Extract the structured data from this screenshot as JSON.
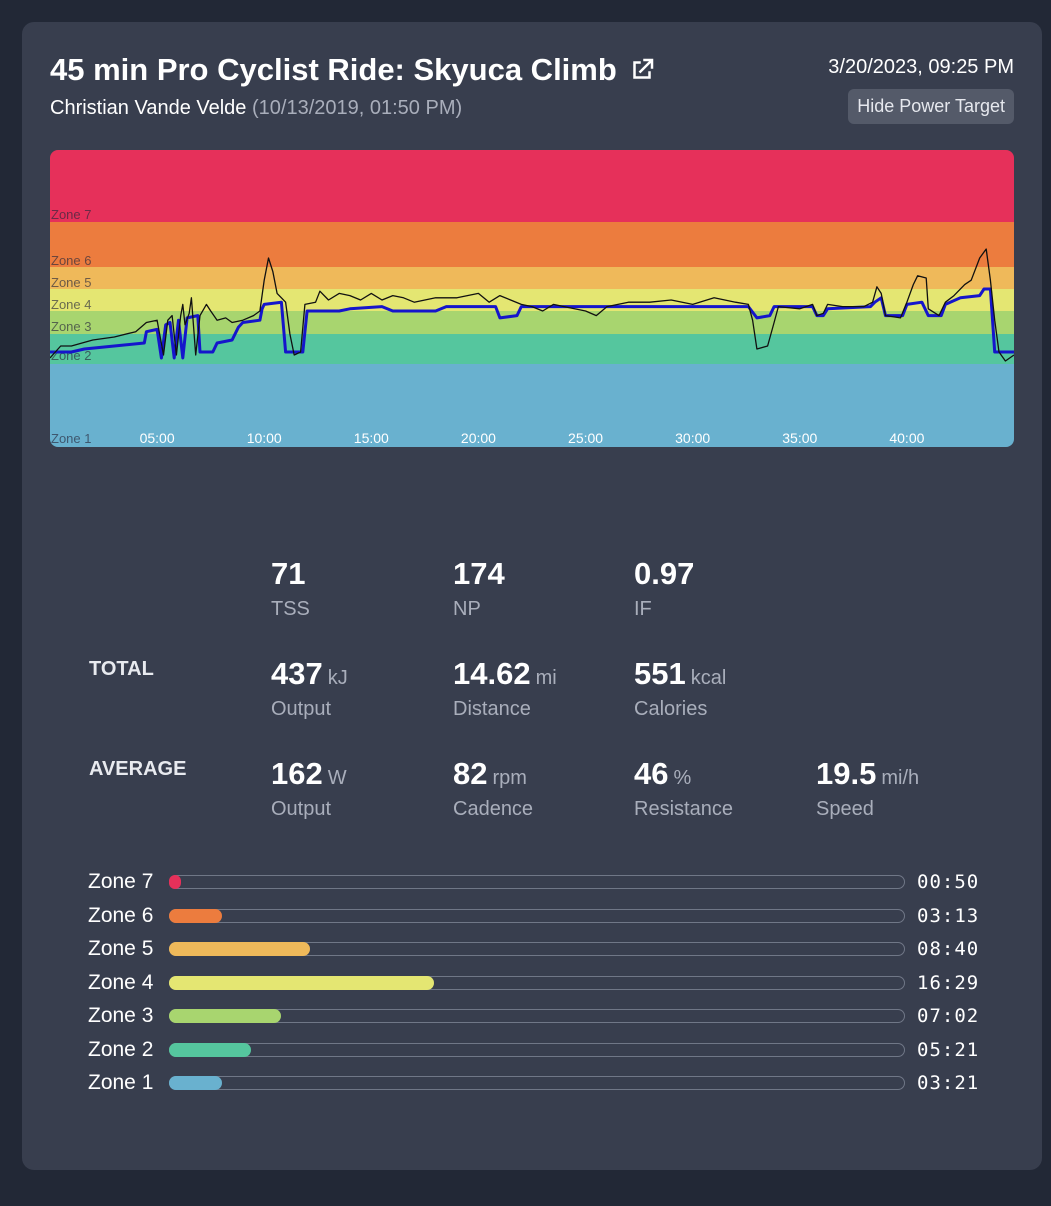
{
  "header": {
    "title": "45 min Pro Cyclist Ride: Skyuca Climb",
    "instructor": "Christian Vande Velde",
    "class_date": "(10/13/2019, 01:50 PM)",
    "ride_datetime": "3/20/2023, 09:25 PM",
    "hide_power_button": "Hide Power Target"
  },
  "chart_data": {
    "type": "line",
    "x_unit": "minutes",
    "xlim": [
      0,
      45
    ],
    "x_ticks": [
      "05:00",
      "10:00",
      "15:00",
      "20:00",
      "25:00",
      "30:00",
      "35:00",
      "40:00"
    ],
    "x_tick_values": [
      5,
      10,
      15,
      20,
      25,
      30,
      35,
      40
    ],
    "zones": [
      {
        "name": "Zone 1",
        "color": "#69b1cf"
      },
      {
        "name": "Zone 2",
        "color": "#55c69e"
      },
      {
        "name": "Zone 3",
        "color": "#a8d56f"
      },
      {
        "name": "Zone 4",
        "color": "#e4e672"
      },
      {
        "name": "Zone 5",
        "color": "#efb95a"
      },
      {
        "name": "Zone 6",
        "color": "#ec7c3e"
      },
      {
        "name": "Zone 7",
        "color": "#e6305a"
      }
    ],
    "series": [
      {
        "color": "#1515cc",
        "points": [
          [
            0,
            1.4
          ],
          [
            1,
            1.4
          ],
          [
            1.6,
            1.5
          ],
          [
            3,
            1.6
          ],
          [
            4.4,
            1.7
          ],
          [
            4.5,
            2.1
          ],
          [
            5,
            2.2
          ],
          [
            5.2,
            1.2
          ],
          [
            5.4,
            2.4
          ],
          [
            5.6,
            2.5
          ],
          [
            5.8,
            1.2
          ],
          [
            6,
            2.6
          ],
          [
            6.2,
            1.2
          ],
          [
            6.4,
            2.7
          ],
          [
            6.9,
            2.8
          ],
          [
            7,
            1.4
          ],
          [
            7.6,
            1.4
          ],
          [
            7.8,
            1.7
          ],
          [
            8.5,
            1.8
          ],
          [
            8.8,
            2.3
          ],
          [
            9,
            2.5
          ],
          [
            9.8,
            2.6
          ],
          [
            9.9,
            3.1
          ],
          [
            10,
            3.3
          ],
          [
            10.8,
            3.4
          ],
          [
            11,
            1.4
          ],
          [
            11.8,
            1.4
          ],
          [
            12,
            3.0
          ],
          [
            13.5,
            3.0
          ],
          [
            14,
            3.1
          ],
          [
            15.5,
            3.2
          ],
          [
            16,
            3.0
          ],
          [
            18,
            3.0
          ],
          [
            18.5,
            3.2
          ],
          [
            20.8,
            3.2
          ],
          [
            21,
            2.7
          ],
          [
            21.8,
            2.8
          ],
          [
            22,
            3.2
          ],
          [
            32.6,
            3.2
          ],
          [
            33,
            2.7
          ],
          [
            33.6,
            2.8
          ],
          [
            33.8,
            3.2
          ],
          [
            35.6,
            3.2
          ],
          [
            35.8,
            2.8
          ],
          [
            36.1,
            2.8
          ],
          [
            36.3,
            3.1
          ],
          [
            38.3,
            3.2
          ],
          [
            38.5,
            3.4
          ],
          [
            38.8,
            3.6
          ],
          [
            39,
            2.8
          ],
          [
            39.8,
            2.8
          ],
          [
            40,
            3.3
          ],
          [
            40.7,
            3.4
          ],
          [
            41,
            2.8
          ],
          [
            41.6,
            2.8
          ],
          [
            41.8,
            3.3
          ],
          [
            42.5,
            3.6
          ],
          [
            43.4,
            3.7
          ],
          [
            43.6,
            4.0
          ],
          [
            43.9,
            4.0
          ],
          [
            44.1,
            1.4
          ],
          [
            45,
            1.4
          ]
        ]
      },
      {
        "color": "#111111",
        "points": [
          [
            0,
            1.2
          ],
          [
            0.5,
            1.6
          ],
          [
            1,
            1.6
          ],
          [
            1.5,
            1.7
          ],
          [
            2,
            1.8
          ],
          [
            3,
            1.9
          ],
          [
            4,
            2.1
          ],
          [
            4.5,
            2.5
          ],
          [
            5,
            2.6
          ],
          [
            5.3,
            1.3
          ],
          [
            5.5,
            2.6
          ],
          [
            5.7,
            2.8
          ],
          [
            5.9,
            1.3
          ],
          [
            6.1,
            2.8
          ],
          [
            6.2,
            3.3
          ],
          [
            6.3,
            2.4
          ],
          [
            6.5,
            2.9
          ],
          [
            6.6,
            3.6
          ],
          [
            6.8,
            1.3
          ],
          [
            7,
            2.8
          ],
          [
            7.3,
            3.3
          ],
          [
            7.5,
            3.0
          ],
          [
            7.8,
            2.6
          ],
          [
            8.2,
            2.7
          ],
          [
            8.5,
            2.5
          ],
          [
            9,
            2.6
          ],
          [
            9.5,
            2.8
          ],
          [
            9.8,
            3.0
          ],
          [
            10,
            4.4
          ],
          [
            10.2,
            5.2
          ],
          [
            10.4,
            4.8
          ],
          [
            10.6,
            3.8
          ],
          [
            10.8,
            3.6
          ],
          [
            11,
            3.4
          ],
          [
            11.2,
            2.0
          ],
          [
            11.4,
            1.3
          ],
          [
            11.7,
            1.4
          ],
          [
            11.9,
            3.3
          ],
          [
            12.4,
            3.4
          ],
          [
            12.6,
            3.9
          ],
          [
            13,
            3.5
          ],
          [
            13.5,
            3.8
          ],
          [
            14,
            3.7
          ],
          [
            14.5,
            3.5
          ],
          [
            15,
            3.8
          ],
          [
            15.5,
            3.5
          ],
          [
            16,
            3.7
          ],
          [
            16.5,
            3.6
          ],
          [
            17,
            3.4
          ],
          [
            18,
            3.6
          ],
          [
            19,
            3.6
          ],
          [
            20,
            3.8
          ],
          [
            20.5,
            3.4
          ],
          [
            21,
            3.7
          ],
          [
            21.5,
            3.5
          ],
          [
            22,
            3.3
          ],
          [
            22.5,
            3.2
          ],
          [
            23,
            3.0
          ],
          [
            23.5,
            3.3
          ],
          [
            24,
            3.2
          ],
          [
            25,
            3.0
          ],
          [
            25.5,
            2.8
          ],
          [
            26,
            3.2
          ],
          [
            27,
            3.4
          ],
          [
            28,
            3.4
          ],
          [
            29,
            3.5
          ],
          [
            30,
            3.3
          ],
          [
            31,
            3.6
          ],
          [
            32,
            3.4
          ],
          [
            32.6,
            3.3
          ],
          [
            32.8,
            2.6
          ],
          [
            33,
            1.5
          ],
          [
            33.5,
            1.6
          ],
          [
            33.8,
            2.5
          ],
          [
            34,
            3.2
          ],
          [
            35,
            3.1
          ],
          [
            35.6,
            3.3
          ],
          [
            35.8,
            2.8
          ],
          [
            36.1,
            2.9
          ],
          [
            36.3,
            3.3
          ],
          [
            37,
            3.2
          ],
          [
            38,
            3.2
          ],
          [
            38.4,
            3.4
          ],
          [
            38.6,
            4.1
          ],
          [
            38.8,
            3.8
          ],
          [
            39,
            2.8
          ],
          [
            39.7,
            2.7
          ],
          [
            40,
            3.4
          ],
          [
            40.3,
            4.2
          ],
          [
            40.5,
            4.6
          ],
          [
            40.9,
            4.5
          ],
          [
            41,
            3.1
          ],
          [
            41.5,
            2.8
          ],
          [
            41.8,
            3.4
          ],
          [
            42.2,
            3.7
          ],
          [
            42.7,
            4.2
          ],
          [
            43,
            4.4
          ],
          [
            43.4,
            5.2
          ],
          [
            43.7,
            5.4
          ],
          [
            43.9,
            4.4
          ],
          [
            44.1,
            2.6
          ],
          [
            44.3,
            1.4
          ],
          [
            44.6,
            1.1
          ],
          [
            45,
            1.3
          ]
        ]
      }
    ]
  },
  "stats": {
    "headline": [
      {
        "value": "71",
        "unit": "",
        "label": "TSS"
      },
      {
        "value": "174",
        "unit": "",
        "label": "NP"
      },
      {
        "value": "0.97",
        "unit": "",
        "label": "IF"
      }
    ],
    "total": {
      "label": "TOTAL",
      "items": [
        {
          "value": "437",
          "unit": "kJ",
          "label": "Output"
        },
        {
          "value": "14.62",
          "unit": "mi",
          "label": "Distance"
        },
        {
          "value": "551",
          "unit": "kcal",
          "label": "Calories"
        }
      ]
    },
    "average": {
      "label": "AVERAGE",
      "items": [
        {
          "value": "162",
          "unit": "W",
          "label": "Output"
        },
        {
          "value": "82",
          "unit": "rpm",
          "label": "Cadence"
        },
        {
          "value": "46",
          "unit": "%",
          "label": "Resistance"
        },
        {
          "value": "19.5",
          "unit": "mi/h",
          "label": "Speed"
        }
      ]
    }
  },
  "zone_times": [
    {
      "name": "Zone 7",
      "time": "00:50",
      "fraction": 0.016,
      "color": "#e6305a"
    },
    {
      "name": "Zone 6",
      "time": "03:13",
      "fraction": 0.072,
      "color": "#ec7c3e"
    },
    {
      "name": "Zone 5",
      "time": "08:40",
      "fraction": 0.192,
      "color": "#efb95a"
    },
    {
      "name": "Zone 4",
      "time": "16:29",
      "fraction": 0.361,
      "color": "#e4e672"
    },
    {
      "name": "Zone 3",
      "time": "07:02",
      "fraction": 0.152,
      "color": "#a8d56f"
    },
    {
      "name": "Zone 2",
      "time": "05:21",
      "fraction": 0.112,
      "color": "#55c69e"
    },
    {
      "name": "Zone 1",
      "time": "03:21",
      "fraction": 0.072,
      "color": "#69b1cf"
    }
  ]
}
